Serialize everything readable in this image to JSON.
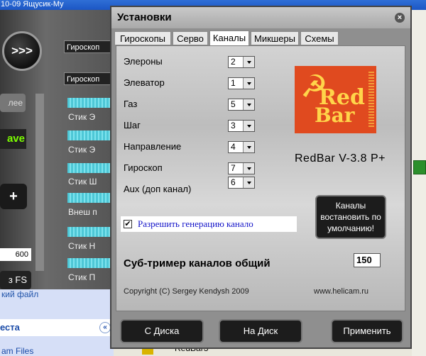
{
  "background": {
    "top_text": " 10-09 Ящусик-Му",
    "circle_label": ">>>",
    "combo1": "Гироскоп",
    "combo2": "Гироскоп",
    "partial_button": "лее",
    "green_text": "ave",
    "plus": "+",
    "value_field": "600",
    "fs_button": "з FS",
    "sticks": [
      "Стик Э",
      "Стик Э",
      "Стик Ш",
      "Внеш п",
      "Стик Н",
      "Стик П"
    ],
    "file_link": "кий файл",
    "section": "еста",
    "collapse": "«",
    "program_files": "am Files",
    "bottom_item": "RedBar3"
  },
  "dialog": {
    "title": "Установки",
    "close": "×",
    "tabs": [
      {
        "label": "Гироскопы"
      },
      {
        "label": "Серво"
      },
      {
        "label": "Каналы"
      },
      {
        "label": "Микшеры"
      },
      {
        "label": "Схемы"
      }
    ],
    "active_tab": "Каналы",
    "channels": [
      {
        "label": "Элероны",
        "value": "2"
      },
      {
        "label": "Элеватор",
        "value": "1"
      },
      {
        "label": "Газ",
        "value": "5"
      },
      {
        "label": "Шаг",
        "value": "3"
      },
      {
        "label": "Направление",
        "value": "4"
      },
      {
        "label": "Гироскоп",
        "value": "7"
      },
      {
        "label": "Aux (доп канал)",
        "value": "6"
      }
    ],
    "logo": {
      "line1": "Red",
      "line2": "Bar",
      "symbol": "☭"
    },
    "version": "RedBar V-3.8 P+",
    "enable_generation": {
      "label": "Разрешить генерацию канало",
      "checked_mark": "✔"
    },
    "reset_button": "Каналы востановить по умолчанию!",
    "subtrim": {
      "label": "Суб-тример каналов общий",
      "value": "150"
    },
    "copyright": "Copyright (C) Sergey Kendysh 2009",
    "site": "www.helicam.ru",
    "buttons": {
      "from_disk": "С Диска",
      "to_disk": "На Диск",
      "apply": "Применить"
    }
  }
}
